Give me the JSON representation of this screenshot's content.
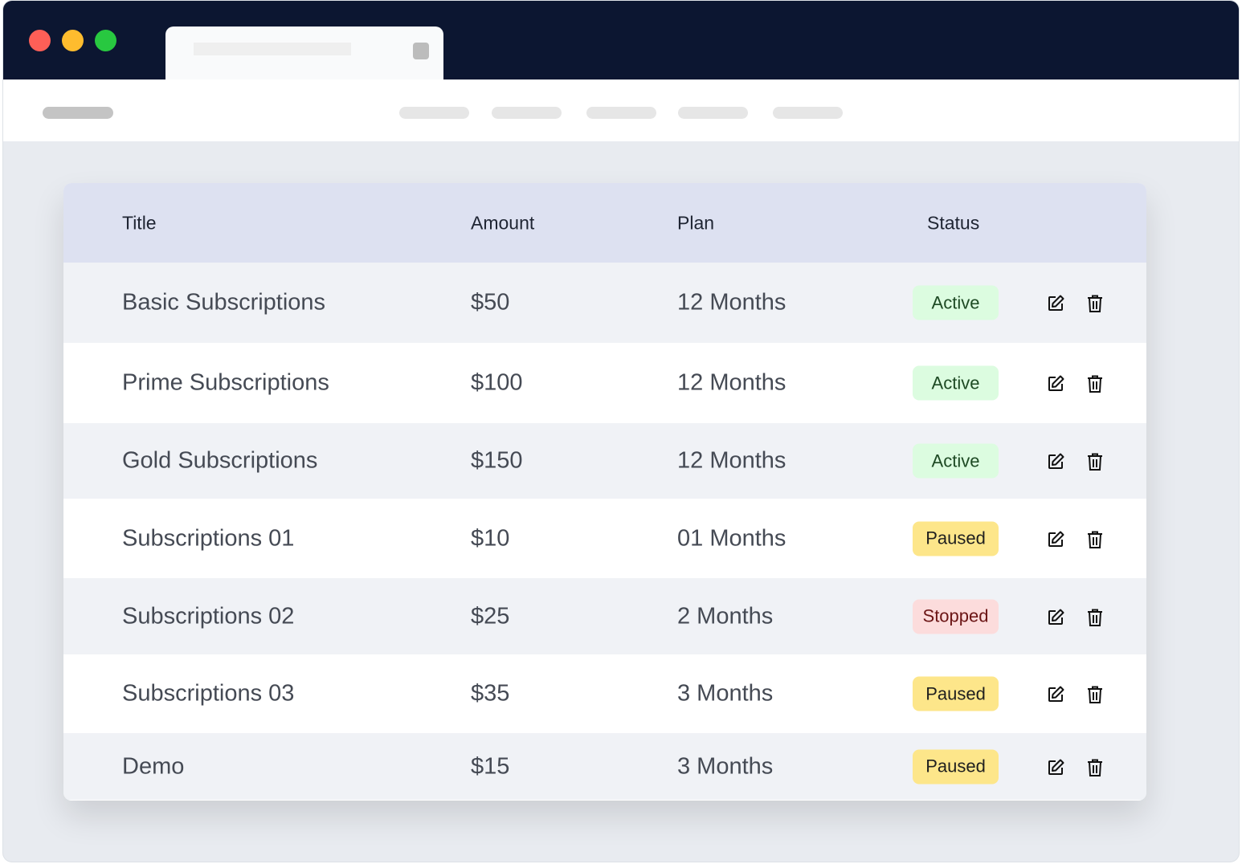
{
  "table": {
    "headers": [
      "Title",
      "Amount",
      "Plan",
      "Status"
    ],
    "rows": [
      {
        "title": "Basic Subscriptions",
        "amount": "$50",
        "plan": "12 Months",
        "status": "Active"
      },
      {
        "title": "Prime Subscriptions",
        "amount": "$100",
        "plan": "12 Months",
        "status": "Active"
      },
      {
        "title": "Gold Subscriptions",
        "amount": "$150",
        "plan": "12 Months",
        "status": "Active"
      },
      {
        "title": "Subscriptions 01",
        "amount": "$10",
        "plan": "01 Months",
        "status": "Paused"
      },
      {
        "title": "Subscriptions 02",
        "amount": "$25",
        "plan": "2 Months",
        "status": "Stopped"
      },
      {
        "title": "Subscriptions 03",
        "amount": "$35",
        "plan": "3 Months",
        "status": "Paused"
      },
      {
        "title": "Demo",
        "amount": "$15",
        "plan": "3 Months",
        "status": "Paused"
      }
    ]
  },
  "status_colors": {
    "Active": {
      "bg": "#dcfce0",
      "fg": "#1e4a24"
    },
    "Paused": {
      "bg": "#fde68a",
      "fg": "#1f1f1f"
    },
    "Stopped": {
      "bg": "#fcdcdc",
      "fg": "#6b1515"
    }
  }
}
